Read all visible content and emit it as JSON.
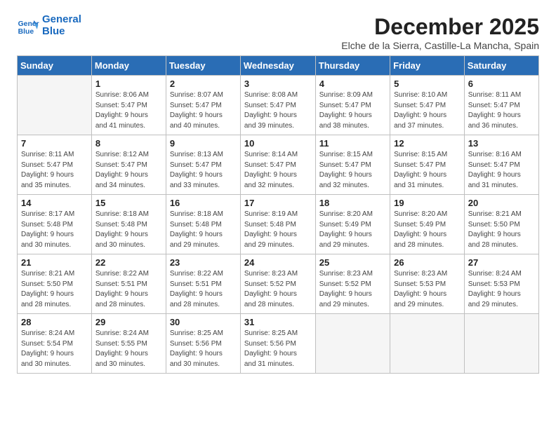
{
  "logo": {
    "line1": "General",
    "line2": "Blue"
  },
  "title": "December 2025",
  "subtitle": "Elche de la Sierra, Castille-La Mancha, Spain",
  "days_of_week": [
    "Sunday",
    "Monday",
    "Tuesday",
    "Wednesday",
    "Thursday",
    "Friday",
    "Saturday"
  ],
  "weeks": [
    [
      {
        "day": "",
        "info": ""
      },
      {
        "day": "1",
        "info": "Sunrise: 8:06 AM\nSunset: 5:47 PM\nDaylight: 9 hours\nand 41 minutes."
      },
      {
        "day": "2",
        "info": "Sunrise: 8:07 AM\nSunset: 5:47 PM\nDaylight: 9 hours\nand 40 minutes."
      },
      {
        "day": "3",
        "info": "Sunrise: 8:08 AM\nSunset: 5:47 PM\nDaylight: 9 hours\nand 39 minutes."
      },
      {
        "day": "4",
        "info": "Sunrise: 8:09 AM\nSunset: 5:47 PM\nDaylight: 9 hours\nand 38 minutes."
      },
      {
        "day": "5",
        "info": "Sunrise: 8:10 AM\nSunset: 5:47 PM\nDaylight: 9 hours\nand 37 minutes."
      },
      {
        "day": "6",
        "info": "Sunrise: 8:11 AM\nSunset: 5:47 PM\nDaylight: 9 hours\nand 36 minutes."
      }
    ],
    [
      {
        "day": "7",
        "info": "Sunrise: 8:11 AM\nSunset: 5:47 PM\nDaylight: 9 hours\nand 35 minutes."
      },
      {
        "day": "8",
        "info": "Sunrise: 8:12 AM\nSunset: 5:47 PM\nDaylight: 9 hours\nand 34 minutes."
      },
      {
        "day": "9",
        "info": "Sunrise: 8:13 AM\nSunset: 5:47 PM\nDaylight: 9 hours\nand 33 minutes."
      },
      {
        "day": "10",
        "info": "Sunrise: 8:14 AM\nSunset: 5:47 PM\nDaylight: 9 hours\nand 32 minutes."
      },
      {
        "day": "11",
        "info": "Sunrise: 8:15 AM\nSunset: 5:47 PM\nDaylight: 9 hours\nand 32 minutes."
      },
      {
        "day": "12",
        "info": "Sunrise: 8:15 AM\nSunset: 5:47 PM\nDaylight: 9 hours\nand 31 minutes."
      },
      {
        "day": "13",
        "info": "Sunrise: 8:16 AM\nSunset: 5:47 PM\nDaylight: 9 hours\nand 31 minutes."
      }
    ],
    [
      {
        "day": "14",
        "info": "Sunrise: 8:17 AM\nSunset: 5:48 PM\nDaylight: 9 hours\nand 30 minutes."
      },
      {
        "day": "15",
        "info": "Sunrise: 8:18 AM\nSunset: 5:48 PM\nDaylight: 9 hours\nand 30 minutes."
      },
      {
        "day": "16",
        "info": "Sunrise: 8:18 AM\nSunset: 5:48 PM\nDaylight: 9 hours\nand 29 minutes."
      },
      {
        "day": "17",
        "info": "Sunrise: 8:19 AM\nSunset: 5:48 PM\nDaylight: 9 hours\nand 29 minutes."
      },
      {
        "day": "18",
        "info": "Sunrise: 8:20 AM\nSunset: 5:49 PM\nDaylight: 9 hours\nand 29 minutes."
      },
      {
        "day": "19",
        "info": "Sunrise: 8:20 AM\nSunset: 5:49 PM\nDaylight: 9 hours\nand 28 minutes."
      },
      {
        "day": "20",
        "info": "Sunrise: 8:21 AM\nSunset: 5:50 PM\nDaylight: 9 hours\nand 28 minutes."
      }
    ],
    [
      {
        "day": "21",
        "info": "Sunrise: 8:21 AM\nSunset: 5:50 PM\nDaylight: 9 hours\nand 28 minutes."
      },
      {
        "day": "22",
        "info": "Sunrise: 8:22 AM\nSunset: 5:51 PM\nDaylight: 9 hours\nand 28 minutes."
      },
      {
        "day": "23",
        "info": "Sunrise: 8:22 AM\nSunset: 5:51 PM\nDaylight: 9 hours\nand 28 minutes."
      },
      {
        "day": "24",
        "info": "Sunrise: 8:23 AM\nSunset: 5:52 PM\nDaylight: 9 hours\nand 28 minutes."
      },
      {
        "day": "25",
        "info": "Sunrise: 8:23 AM\nSunset: 5:52 PM\nDaylight: 9 hours\nand 29 minutes."
      },
      {
        "day": "26",
        "info": "Sunrise: 8:23 AM\nSunset: 5:53 PM\nDaylight: 9 hours\nand 29 minutes."
      },
      {
        "day": "27",
        "info": "Sunrise: 8:24 AM\nSunset: 5:53 PM\nDaylight: 9 hours\nand 29 minutes."
      }
    ],
    [
      {
        "day": "28",
        "info": "Sunrise: 8:24 AM\nSunset: 5:54 PM\nDaylight: 9 hours\nand 30 minutes."
      },
      {
        "day": "29",
        "info": "Sunrise: 8:24 AM\nSunset: 5:55 PM\nDaylight: 9 hours\nand 30 minutes."
      },
      {
        "day": "30",
        "info": "Sunrise: 8:25 AM\nSunset: 5:56 PM\nDaylight: 9 hours\nand 30 minutes."
      },
      {
        "day": "31",
        "info": "Sunrise: 8:25 AM\nSunset: 5:56 PM\nDaylight: 9 hours\nand 31 minutes."
      },
      {
        "day": "",
        "info": ""
      },
      {
        "day": "",
        "info": ""
      },
      {
        "day": "",
        "info": ""
      }
    ]
  ]
}
